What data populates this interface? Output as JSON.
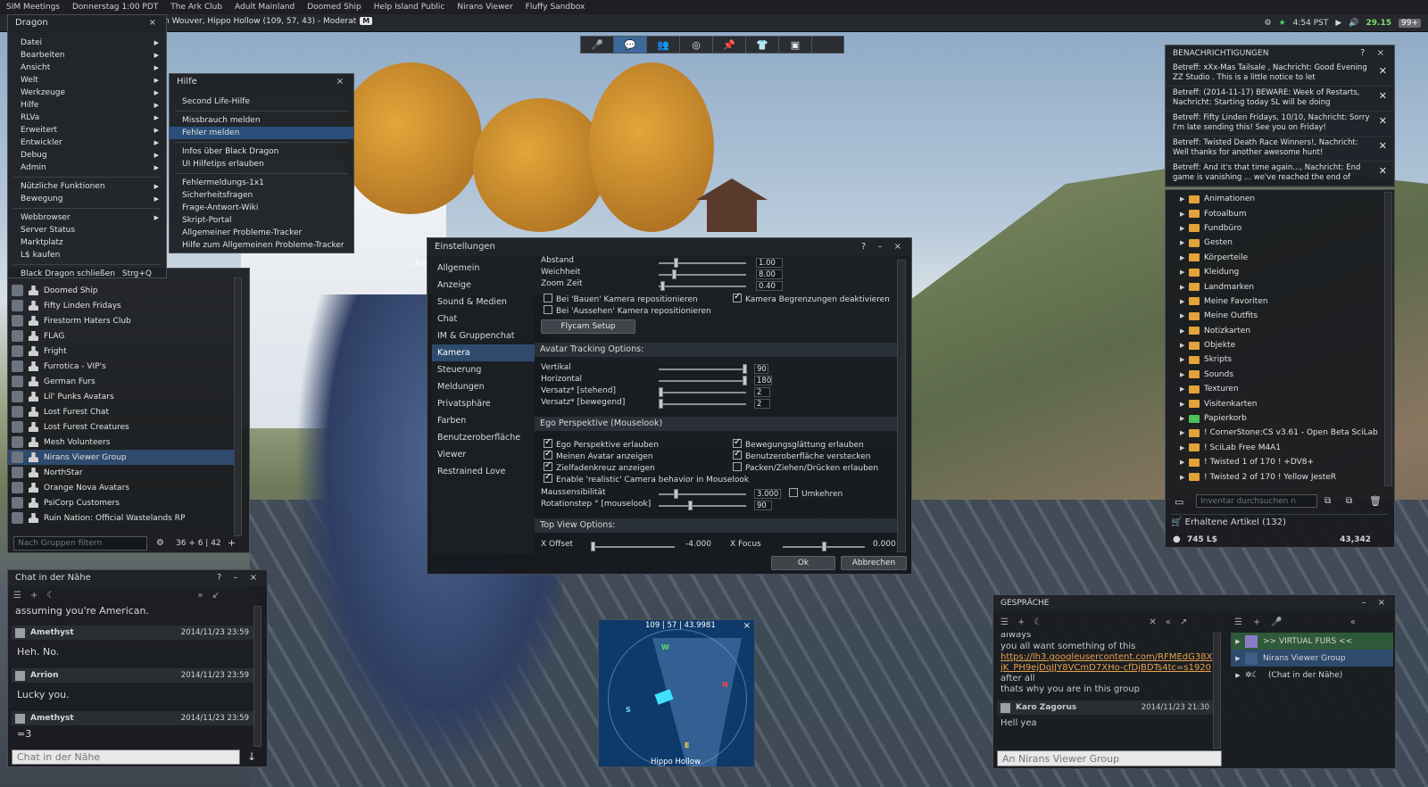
{
  "menubar": {
    "items": [
      "SIM Meetings",
      "Donnerstag 1:00 PDT",
      "The Ark Club",
      "Adult Mainland",
      "Doomed Ship",
      "Help Island Public",
      "Nirans Viewer",
      "Fluffy Sandbox"
    ]
  },
  "location": {
    "text": "n Wouver, Hippo Hollow (109, 57, 43) - Moderat",
    "badge": "M"
  },
  "status": {
    "time": "4:54 PST",
    "fps": "29.15",
    "battery": "99+"
  },
  "dragon_menu": {
    "title": "Dragon",
    "close": "×",
    "items": [
      "Datei",
      "Bearbeiten",
      "Ansicht",
      "Welt",
      "Werkzeuge",
      "Hilfe",
      "RLVa",
      "Erweitert",
      "Entwickler",
      "Debug",
      "Admin"
    ],
    "group2": [
      "Nützliche Funktionen",
      "Bewegung"
    ],
    "group3": [
      "Webbrowser",
      "Server Status",
      "Marktplatz",
      "L$ kaufen"
    ],
    "quit": "Black Dragon schließen",
    "quit_shortcut": "Strg+Q"
  },
  "help_menu": {
    "title": "Hilfe",
    "items": [
      "Second Life-Hilfe",
      "Missbrauch melden",
      "Fehler melden",
      "Infos über Black Dragon",
      "UI Hilfetips erlauben",
      "Fehlermeldungs-1x1",
      "Sicherheitsfragen",
      "Frage-Antwort-Wiki",
      "Skript-Portal",
      "Allgemeiner Probleme-Tracker",
      "Hilfe zum Allgemeinen Probleme-Tracker"
    ]
  },
  "groups": {
    "items": [
      "Doomed Ship",
      "Fifty Linden Fridays",
      "Firestorm Haters Club",
      "FLAG",
      "Fright",
      "Furrotica - VIP's",
      "German Furs",
      "Lil' Punks Avatars",
      "Lost Furest Chat",
      "Lost Furest Creatures",
      "Mesh Volunteers",
      "Nirans Viewer Group",
      "NorthStar",
      "Orange Nova Avatars",
      "PsiCorp Customers",
      "Ruin Nation: Official Wastelands RP"
    ],
    "filter_placeholder": "Nach Gruppen filtern",
    "count": "36 + 6 | 42"
  },
  "settings": {
    "title": "Einstellungen",
    "categories": [
      "Allgemein",
      "Anzeige",
      "Sound & Medien",
      "Chat",
      "IM & Gruppenchat",
      "Kamera",
      "Steuerung",
      "Meldungen",
      "Privatsphäre",
      "Farben",
      "Benutzeroberfläche",
      "Viewer",
      "Restrained Love"
    ],
    "abstand_label": "Abstand",
    "abstand_value": "1.00",
    "weichheit_label": "Weichheit",
    "weichheit_value": "8.00",
    "zoom_label": "Zoom Zeit",
    "zoom_value": "0.40",
    "cb_bauen": "Bei 'Bauen' Kamera repositionieren",
    "cb_aussehen": "Bei 'Aussehen' Kamera repositionieren",
    "cb_begrenzung": "Kamera Begrenzungen deaktivieren",
    "flycam": "Flycam Setup",
    "avatar_tracking": "Avatar Tracking Options:",
    "vertikal_label": "Vertikal",
    "vertikal_value": "90",
    "horizontal_label": "Horizontal",
    "horizontal_value": "180",
    "versatz_stehend_label": "Versatz* [stehend]",
    "versatz_stehend_value": "2",
    "versatz_bewegend_label": "Versatz* [bewegend]",
    "versatz_bewegend_value": "2",
    "ego_section": "Ego Perspektive (Mouselook)",
    "cb_ego": "Ego Perspektive erlauben",
    "cb_meinen": "Meinen Avatar anzeigen",
    "cb_ziel": "Zielfadenkreuz anzeigen",
    "cb_realistic": "Enable 'realistic' Camera behavior in Mouselook",
    "cb_glaettung": "Bewegungsglättung erlauben",
    "cb_ui_hide": "Benutzeroberfläche verstecken",
    "cb_packen": "Packen/Ziehen/Drücken erlauben",
    "maus_label": "Maussensibilität",
    "maus_value": "3.000",
    "umkehren": "Umkehren",
    "rot_label": "Rotationstep ° [mouselook]",
    "rot_value": "90",
    "topview": "Top View Options:",
    "xoffset_label": "X Offset",
    "xoffset_value": "-4.000",
    "xfocus_label": "X Focus",
    "xfocus_value": "0.000",
    "ok": "Ok",
    "cancel": "Abbrechen"
  },
  "notifications": {
    "title": "BENACHRICHTIGUNGEN",
    "items": [
      "Betreff: xXx-Mas Tailsale , Nachricht: Good Evening ZZ Studio . This is a little notice to let",
      "Betreff: (2014-11-17) BEWARE: Week of Restarts, Nachricht: Starting today SL will be doing",
      "Betreff: Fifty Linden Fridays, 10/10, Nachricht: Sorry I'm late sending this! See you on Friday!",
      "Betreff: Twisted Death Race Winners!, Nachricht: Well thanks for another awesome hunt!",
      "Betreff: And it's that time again..., Nachricht: End game is vanishing ... we've reached the end of"
    ]
  },
  "inventory": {
    "items": [
      "Animationen",
      "Fotoalbum",
      "Fundbüro",
      "Gesten",
      "Körperteile",
      "Kleidung",
      "Landmarken",
      "Meine Favoriten",
      "Meine Outfits",
      "Notizkarten",
      "Objekte",
      "Skripts",
      "Sounds",
      "Texturen",
      "Visitenkarten",
      "Papierkorb",
      "! CornerStone:CS v3.61 - Open Beta SciLab",
      "! SciLab Free M4A1",
      "! Twisted 1 of 170 ! +DV8+",
      "! Twisted 2 of 170 ! Yellow JesteR"
    ],
    "search_placeholder": "Inventar durchsuchen n",
    "received": "Erhaltene Artikel (132)",
    "balance": "745 L$",
    "count": "43,342"
  },
  "nearby_chat": {
    "title": "Chat in der Nähe",
    "line0": "assuming you're American.",
    "messages": [
      {
        "name": "Amethyst",
        "time": "2014/11/23 23:59",
        "text": "Heh. No."
      },
      {
        "name": "Arrion",
        "time": "2014/11/23 23:59",
        "text": "Lucky you."
      },
      {
        "name": "Amethyst",
        "time": "2014/11/23 23:59",
        "text": "=3"
      }
    ],
    "input_placeholder": "Chat in der Nähe"
  },
  "minimap": {
    "coords": "109 | 57 | 43.9981",
    "region": "Hippo Hollow",
    "dir_w": "W",
    "dir_n": "N",
    "dir_s": "S",
    "dir_e": "E"
  },
  "conversations": {
    "title": "GESPRÄCHE",
    "line_always": "always",
    "line1": "you all want something of this",
    "link": "https://lh3.googleusercontent.com/RFMEdG38XjK_PH9ejDqJJY8VCmD7XHo-cfDjBDTs4tc=s1920",
    "link_tail": "after all",
    "line2": "thats why you are in this group",
    "sender": "Karo Zagorus",
    "sender_time": "2014/11/23 21:30",
    "last": "Hell yea",
    "input_placeholder": "An Nirans Viewer Group",
    "list": [
      ">> VIRTUAL FURS <<",
      "Nirans Viewer Group",
      "(Chat in der Nähe)"
    ]
  },
  "overlay_label": "Am"
}
